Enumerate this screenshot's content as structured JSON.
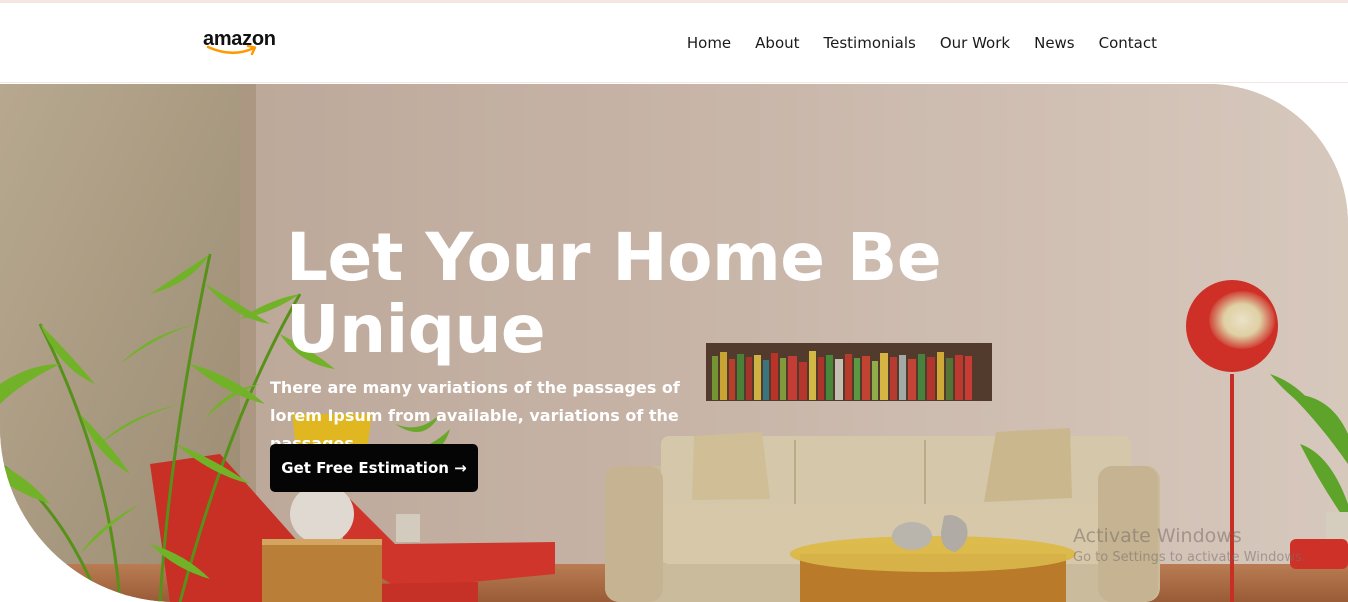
{
  "brand": {
    "logo_text": "amazon",
    "accent": "#ff9900"
  },
  "nav": {
    "items": [
      {
        "label": "Home"
      },
      {
        "label": "About"
      },
      {
        "label": "Testimonials"
      },
      {
        "label": "Our Work"
      },
      {
        "label": "News"
      },
      {
        "label": "Contact"
      }
    ]
  },
  "hero": {
    "title": "Let Your Home Be Unique",
    "subtitle": "There are many variations of the passages of lorem Ipsum from available, variations of the passages.",
    "cta_label": "Get Free Estimation →",
    "cta_color": "#050505"
  },
  "watermark": {
    "title": "Activate Windows",
    "subtitle": "Go to Settings to activate Windows."
  }
}
